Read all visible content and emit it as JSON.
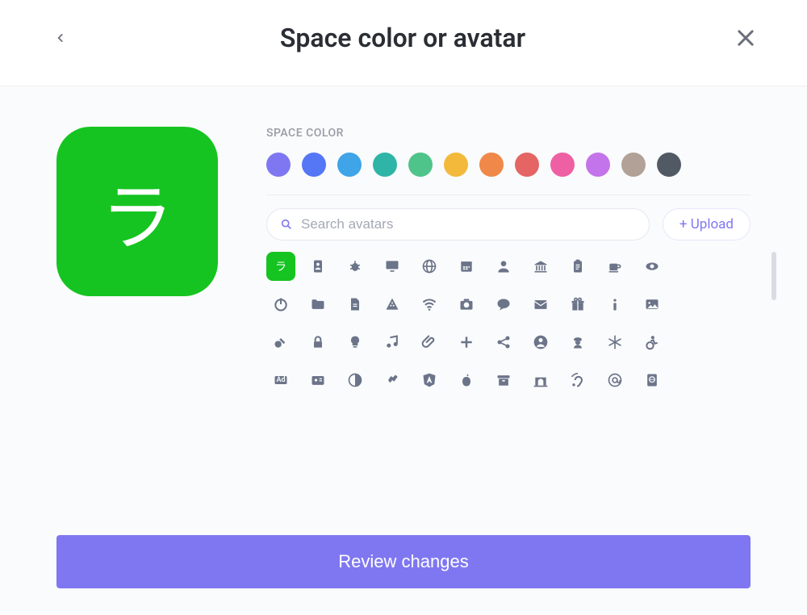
{
  "header": {
    "title": "Space color or avatar"
  },
  "preview": {
    "char": "ラ",
    "bg": "#15c420"
  },
  "section_label": "SPACE COLOR",
  "swatches": [
    "#7f77f1",
    "#5577f6",
    "#3fa4e8",
    "#2fb5a7",
    "#4fc48a",
    "#f2b93b",
    "#ef8849",
    "#e56565",
    "#ef5fa3",
    "#c474ea",
    "#b1a197",
    "#515a64"
  ],
  "search": {
    "placeholder": "Search avatars"
  },
  "upload_label": "+ Upload",
  "avatars": [
    [
      {
        "name": "char",
        "label": "ラ",
        "selected": true
      },
      {
        "name": "address-book-icon"
      },
      {
        "name": "bug-icon"
      },
      {
        "name": "monitor-icon"
      },
      {
        "name": "globe-icon"
      },
      {
        "name": "calendar-icon"
      },
      {
        "name": "user-icon"
      },
      {
        "name": "bank-icon"
      },
      {
        "name": "clipboard-icon"
      },
      {
        "name": "coffee-icon"
      },
      {
        "name": "eye-icon"
      }
    ],
    [
      {
        "name": "power-icon"
      },
      {
        "name": "folder-icon"
      },
      {
        "name": "file-icon"
      },
      {
        "name": "pizza-icon"
      },
      {
        "name": "wifi-icon"
      },
      {
        "name": "camera-icon"
      },
      {
        "name": "comment-icon"
      },
      {
        "name": "envelope-icon"
      },
      {
        "name": "gift-icon"
      },
      {
        "name": "info-icon"
      },
      {
        "name": "image-icon"
      }
    ],
    [
      {
        "name": "key-icon"
      },
      {
        "name": "lock-icon"
      },
      {
        "name": "lightbulb-icon"
      },
      {
        "name": "music-icon"
      },
      {
        "name": "paperclip-icon"
      },
      {
        "name": "plus-icon"
      },
      {
        "name": "share-icon"
      },
      {
        "name": "user-circle-icon"
      },
      {
        "name": "user-secret-icon"
      },
      {
        "name": "snowflake-icon"
      },
      {
        "name": "accessible-icon"
      }
    ],
    [
      {
        "name": "ad-icon",
        "label": "Ad"
      },
      {
        "name": "id-card-icon"
      },
      {
        "name": "contrast-icon"
      },
      {
        "name": "sign-language-icon"
      },
      {
        "name": "angular-icon"
      },
      {
        "name": "apple-icon"
      },
      {
        "name": "archive-icon"
      },
      {
        "name": "archway-icon"
      },
      {
        "name": "assistive-listening-icon"
      },
      {
        "name": "at-icon"
      },
      {
        "name": "atlas-icon"
      }
    ]
  ],
  "footer": {
    "review": "Review changes"
  }
}
